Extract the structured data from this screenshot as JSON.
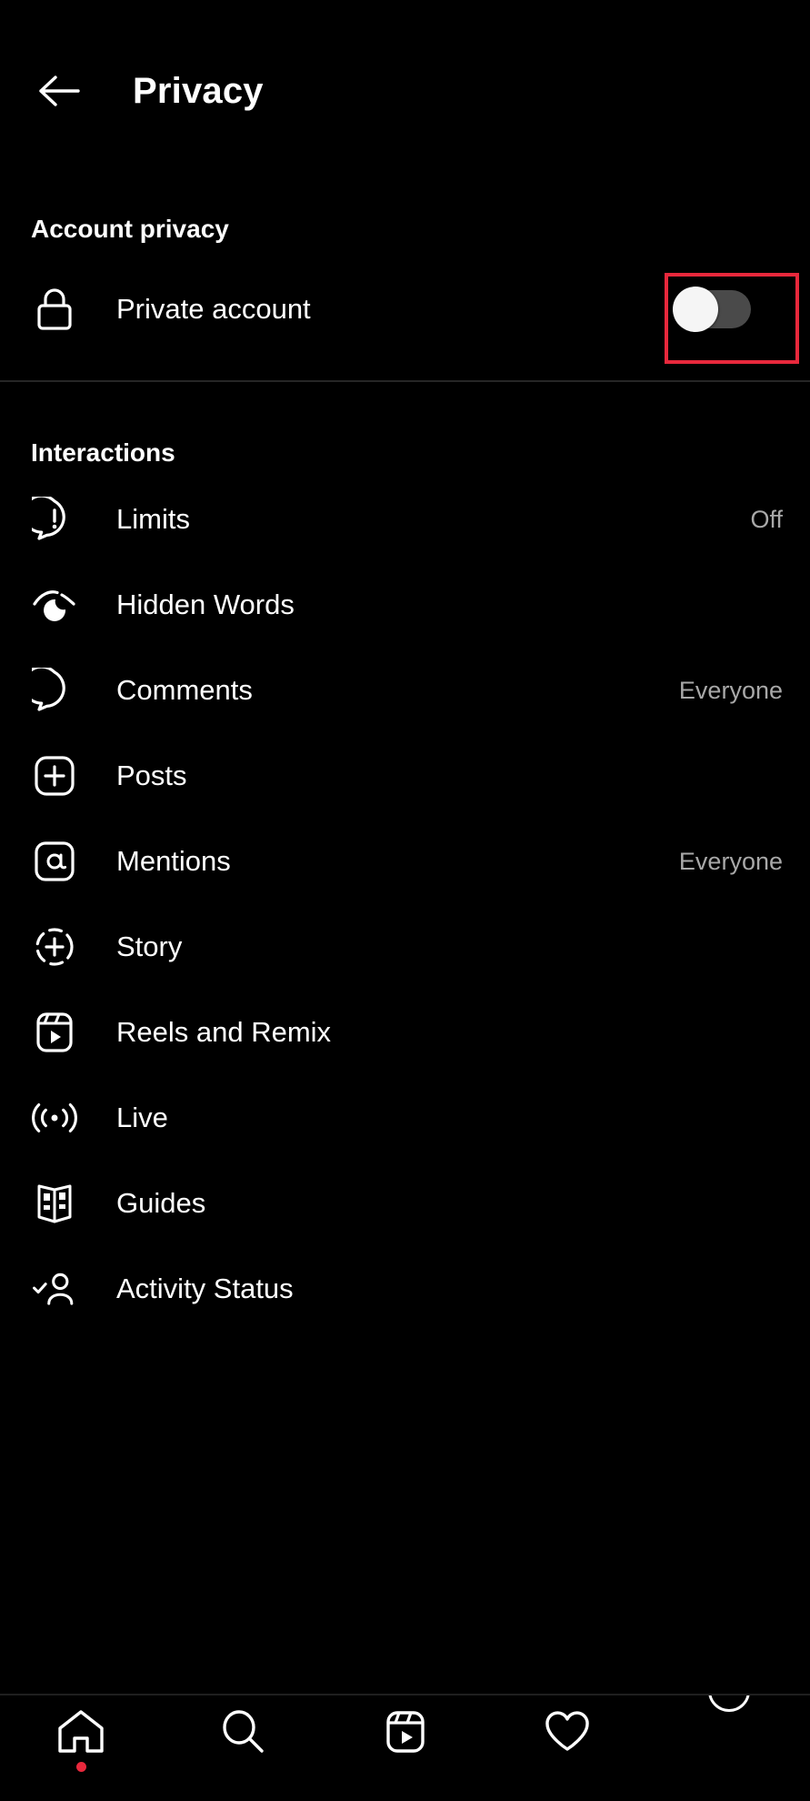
{
  "header": {
    "back_icon": "arrow-left-icon",
    "title": "Privacy"
  },
  "account_privacy": {
    "section_title": "Account privacy",
    "row": {
      "icon": "lock-icon",
      "label": "Private account",
      "toggle": {
        "state": "off",
        "track_color": "#4a4a4a",
        "knob_color": "#f5f5f5",
        "highlighted": true,
        "highlight_color": "#e8283c"
      }
    }
  },
  "interactions": {
    "section_title": "Interactions",
    "items": [
      {
        "icon": "limits-icon",
        "label": "Limits",
        "value": "Off"
      },
      {
        "icon": "hidden-words-icon",
        "label": "Hidden Words",
        "value": ""
      },
      {
        "icon": "comment-bubble-icon",
        "label": "Comments",
        "value": "Everyone"
      },
      {
        "icon": "plus-square-icon",
        "label": "Posts",
        "value": ""
      },
      {
        "icon": "mention-at-icon",
        "label": "Mentions",
        "value": "Everyone"
      },
      {
        "icon": "story-plus-icon",
        "label": "Story",
        "value": ""
      },
      {
        "icon": "reels-icon",
        "label": "Reels and Remix",
        "value": ""
      },
      {
        "icon": "live-broadcast-icon",
        "label": "Live",
        "value": ""
      },
      {
        "icon": "guides-book-icon",
        "label": "Guides",
        "value": ""
      },
      {
        "icon": "activity-status-icon",
        "label": "Activity Status",
        "value": ""
      }
    ]
  },
  "bottom_nav": {
    "items": [
      {
        "icon": "home-icon",
        "badge": true
      },
      {
        "icon": "search-icon",
        "badge": false
      },
      {
        "icon": "reels-icon",
        "badge": false
      },
      {
        "icon": "heart-icon",
        "badge": false
      },
      {
        "icon": "profile-avatar-icon",
        "badge": false
      }
    ]
  },
  "colors": {
    "background": "#000000",
    "text_primary": "#ffffff",
    "text_secondary": "#a8a8a8",
    "divider": "#262626",
    "accent_red": "#e8283c"
  }
}
